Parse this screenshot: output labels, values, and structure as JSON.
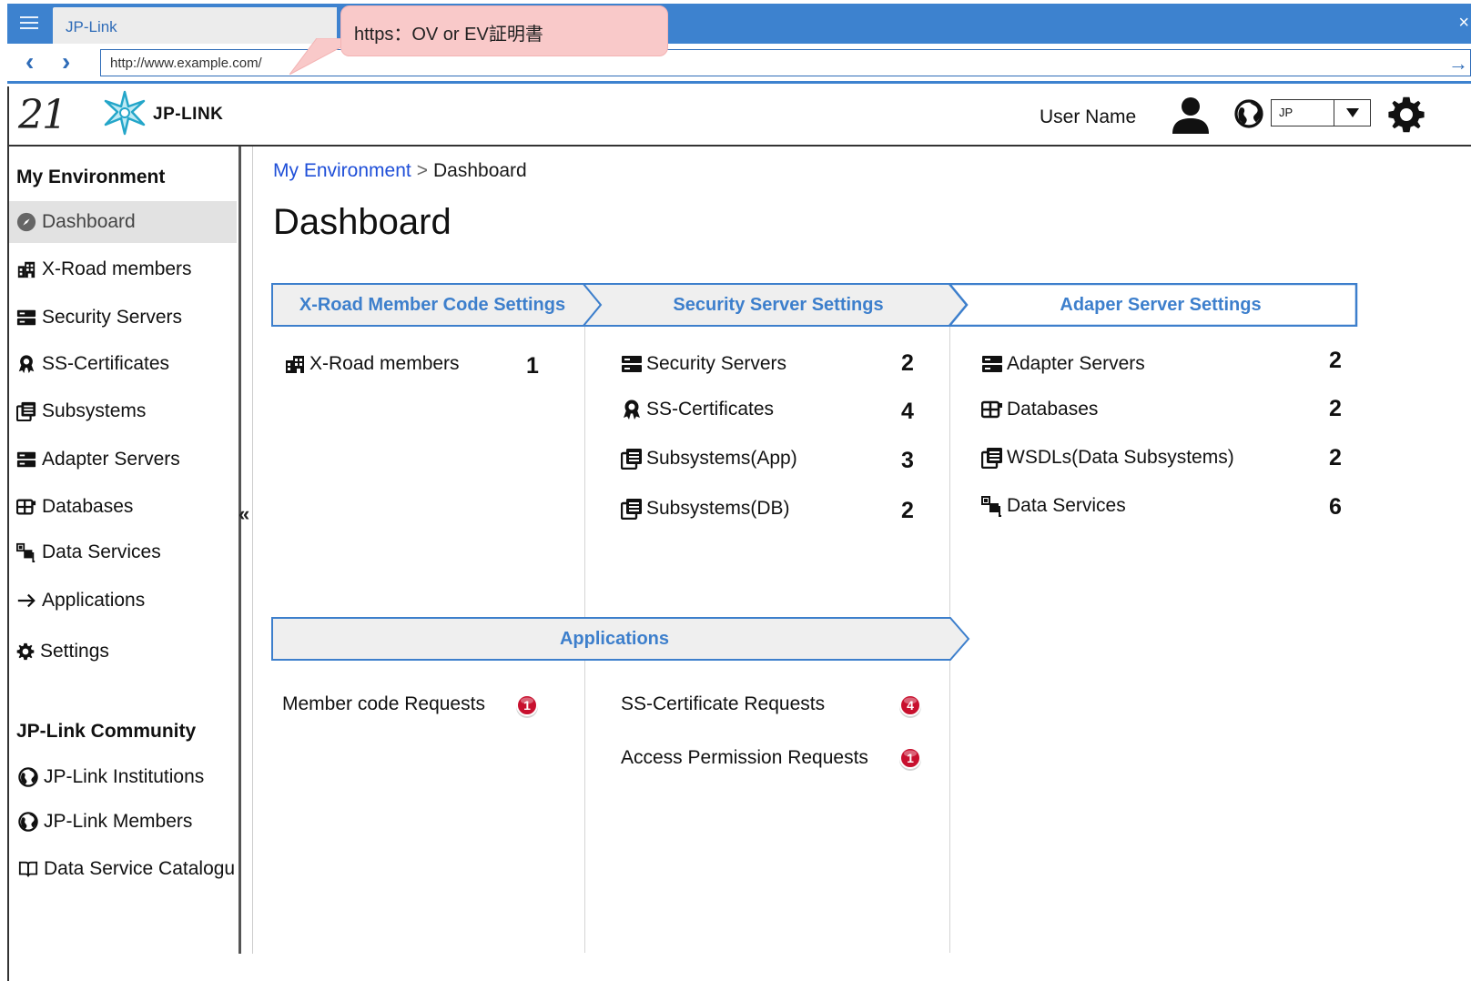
{
  "browser": {
    "tab_title": "JP-Link",
    "url": "http://www.example.com/",
    "close_glyph": "×",
    "back_glyph": "‹",
    "forward_glyph": "›",
    "go_glyph": "→",
    "accent_color": "#3d82cf"
  },
  "callout": {
    "text": "https：OV or EV証明書",
    "color": "#f9c9c9"
  },
  "header": {
    "logo_mark": "21",
    "logo_text": "JP-LINK",
    "user_name": "User Name",
    "language": "JP",
    "icons": [
      "menu-icon",
      "user-icon",
      "globe-icon",
      "gear-icon"
    ]
  },
  "sidebar": {
    "section1_title": "My Environment",
    "items": [
      {
        "label": "Dashboard",
        "icon": "compass-icon",
        "active": true
      },
      {
        "label": "X-Road members",
        "icon": "building-icon"
      },
      {
        "label": "Security Servers",
        "icon": "server-icon"
      },
      {
        "label": "SS-Certificates",
        "icon": "certificate-icon"
      },
      {
        "label": "Subsystems",
        "icon": "subsystem-icon"
      },
      {
        "label": "Adapter Servers",
        "icon": "server-icon"
      },
      {
        "label": "Databases",
        "icon": "database-icon"
      },
      {
        "label": "Data Services",
        "icon": "data-service-icon"
      },
      {
        "label": "Applications",
        "icon": "arrow-right-icon"
      },
      {
        "label": "Settings",
        "icon": "gear-icon"
      }
    ],
    "section2_title": "JP-Link Community",
    "community_items": [
      {
        "label": "JP-Link Institutions",
        "icon": "globe-icon"
      },
      {
        "label": "JP-Link Members",
        "icon": "globe-icon"
      },
      {
        "label": "Data Service Catalogu",
        "icon": "book-icon"
      }
    ],
    "collapse_glyph": "«"
  },
  "main": {
    "breadcrumb_link": "My Environment",
    "breadcrumb_sep": ">",
    "breadcrumb_current": "Dashboard",
    "title": "Dashboard",
    "steps": [
      "X-Road Member Code Settings",
      "Security Server Settings",
      "Adaper Server Settings"
    ],
    "step_color": "#3d7fcc",
    "columns": [
      {
        "rows": [
          {
            "label": "X-Road members",
            "icon": "building-icon",
            "count": "1"
          }
        ]
      },
      {
        "rows": [
          {
            "label": "Security Servers",
            "icon": "server-icon",
            "count": "2"
          },
          {
            "label": "SS-Certificates",
            "icon": "certificate-icon",
            "count": "4"
          },
          {
            "label": "Subsystems(App)",
            "icon": "subsystem-icon",
            "count": "3"
          },
          {
            "label": "Subsystems(DB)",
            "icon": "subsystem-icon",
            "count": "2"
          }
        ]
      },
      {
        "rows": [
          {
            "label": "Adapter Servers",
            "icon": "server-icon",
            "count": "2"
          },
          {
            "label": "Databases",
            "icon": "database-icon",
            "count": "2"
          },
          {
            "label": "WSDLs(Data Subsystems)",
            "icon": "subsystem-icon",
            "count": "2"
          },
          {
            "label": "Data Services",
            "icon": "data-service-icon",
            "count": "6"
          }
        ]
      }
    ],
    "applications_title": "Applications",
    "requests": [
      {
        "label": "Member code Requests",
        "badge": "1"
      },
      {
        "label": "SS-Certificate Requests",
        "badge": "4"
      },
      {
        "label": "Access Permission Requests",
        "badge": "1"
      }
    ],
    "badge_color": "#c8102e"
  }
}
